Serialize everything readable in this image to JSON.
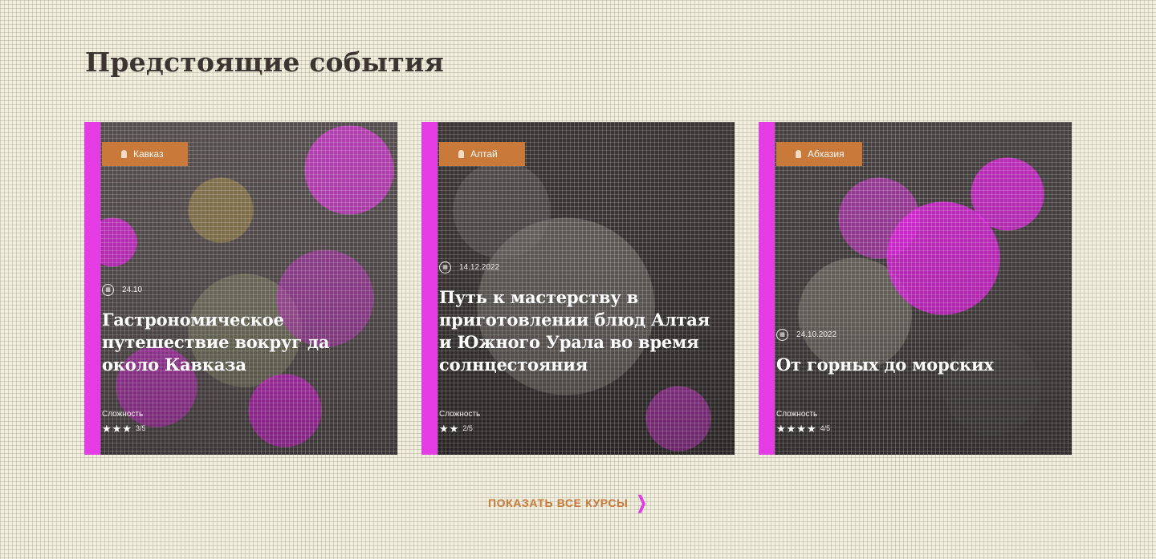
{
  "page": {
    "title": "Предстоящие события",
    "show_all_label": "ПОКАЗАТЬ ВСЕ КУРСЫ"
  },
  "colors": {
    "background": "#f2efde",
    "accent_magenta": "#e63ce6",
    "tag_orange": "#c9793a",
    "title_dark": "#3b3431",
    "card_text": "#ffffff"
  },
  "icons": {
    "tag": "map-pin-icon",
    "date": "calendar-icon",
    "difficulty": "star-icon",
    "show_all": "chevron-right-icon"
  },
  "cards": [
    {
      "tag": "Кавказ",
      "date": "24.10",
      "title": "Гастрономическое путешествие вокруг да около Кавказа",
      "complexity_label": "Сложность",
      "stars": "★★★",
      "stars_note": "3/5"
    },
    {
      "tag": "Алтай",
      "date": "14.12.2022",
      "title": "Путь к мастерству в приготовлении блюд Алтая и Южного Урала во время солнцестояния",
      "complexity_label": "Сложность",
      "stars": "★★",
      "stars_note": "2/5"
    },
    {
      "tag": "Абхазия",
      "date": "24.10.2022",
      "title": "От горных до морских",
      "complexity_label": "Сложность",
      "stars": "★★★★",
      "stars_note": "4/5"
    }
  ]
}
